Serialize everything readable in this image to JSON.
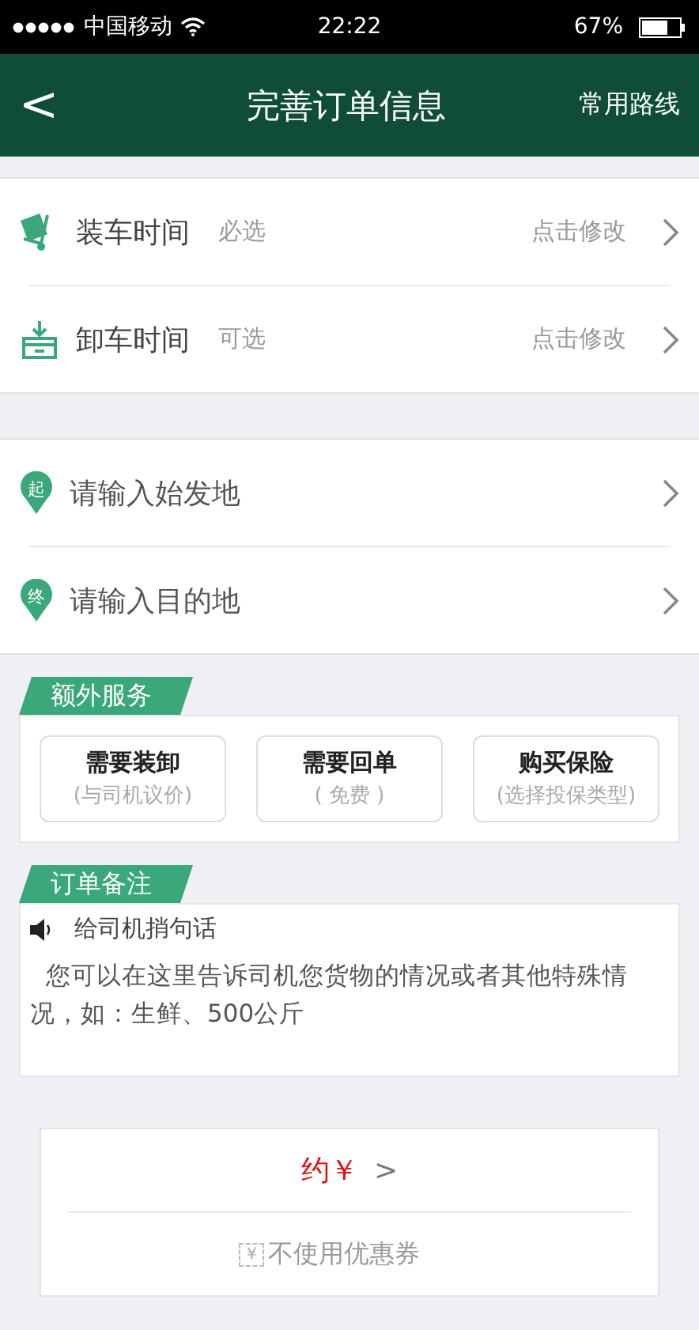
{
  "status_bar": {
    "carrier": "中国移动",
    "time": "22:22",
    "battery": "67%"
  },
  "header": {
    "back": "<",
    "title": "完善订单信息",
    "action": "常用路线"
  },
  "time_rows": [
    {
      "kind": "load",
      "label": "装车时间",
      "hint": "必选",
      "value": "点击修改"
    },
    {
      "kind": "unload",
      "label": "卸车时间",
      "hint": "可选",
      "value": "点击修改"
    }
  ],
  "address_rows": [
    {
      "badge": "起",
      "placeholder": "请输入始发地"
    },
    {
      "badge": "终",
      "placeholder": "请输入目的地"
    }
  ],
  "extra_services": {
    "title": "额外服务",
    "options": [
      {
        "label": "需要装卸",
        "note": "(与司机议价)"
      },
      {
        "label": "需要回单",
        "note": "( 免费 )"
      },
      {
        "label": "购买保险",
        "note": "(选择投保类型)"
      }
    ]
  },
  "order_notes": {
    "title": "订单备注",
    "label": "给司机捎句话",
    "placeholder": "  您可以在这里告诉司机您货物的情况或者其他特殊情况，如：生鲜、500公斤"
  },
  "price": {
    "text": "约￥",
    "arrow": ">"
  },
  "coupon": {
    "icon": "¥",
    "text": "不使用优惠券"
  }
}
